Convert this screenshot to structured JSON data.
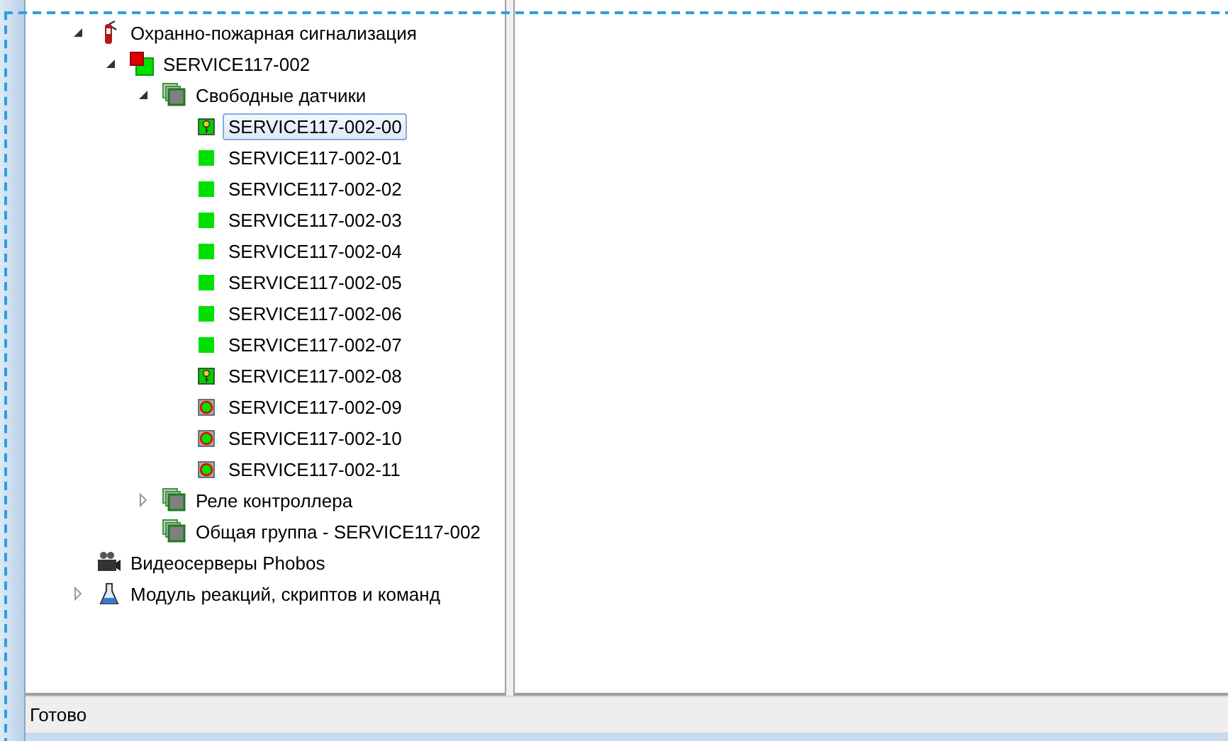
{
  "tree": [
    {
      "label": "Охранно-пожарная сигнализация",
      "kind": "extinguisher",
      "expanded": true,
      "selected": false,
      "children": [
        {
          "label": "SERVICE117-002",
          "kind": "controller",
          "expanded": true,
          "selected": false,
          "children": [
            {
              "label": "Свободные датчики",
              "kind": "group",
              "expanded": true,
              "selected": false,
              "children": [
                {
                  "label": "SERVICE117-002-00",
                  "kind": "key",
                  "selected": true
                },
                {
                  "label": "SERVICE117-002-01",
                  "kind": "ok",
                  "selected": false
                },
                {
                  "label": "SERVICE117-002-02",
                  "kind": "ok",
                  "selected": false
                },
                {
                  "label": "SERVICE117-002-03",
                  "kind": "ok",
                  "selected": false
                },
                {
                  "label": "SERVICE117-002-04",
                  "kind": "ok",
                  "selected": false
                },
                {
                  "label": "SERVICE117-002-05",
                  "kind": "ok",
                  "selected": false
                },
                {
                  "label": "SERVICE117-002-06",
                  "kind": "ok",
                  "selected": false
                },
                {
                  "label": "SERVICE117-002-07",
                  "kind": "ok",
                  "selected": false
                },
                {
                  "label": "SERVICE117-002-08",
                  "kind": "key",
                  "selected": false
                },
                {
                  "label": "SERVICE117-002-09",
                  "kind": "fault",
                  "selected": false
                },
                {
                  "label": "SERVICE117-002-10",
                  "kind": "fault",
                  "selected": false
                },
                {
                  "label": "SERVICE117-002-11",
                  "kind": "fault",
                  "selected": false
                }
              ]
            },
            {
              "label": "Реле контроллера",
              "kind": "group",
              "expanded": false,
              "selected": false
            },
            {
              "label": "Общая группа - SERVICE117-002",
              "kind": "group",
              "selected": false
            }
          ]
        }
      ]
    },
    {
      "label": "Видеосерверы Phobos",
      "kind": "camera",
      "selected": false
    },
    {
      "label": "Модуль реакций, скриптов и команд",
      "kind": "flask",
      "expanded": false,
      "selected": false
    }
  ],
  "status_bar": "Готово"
}
